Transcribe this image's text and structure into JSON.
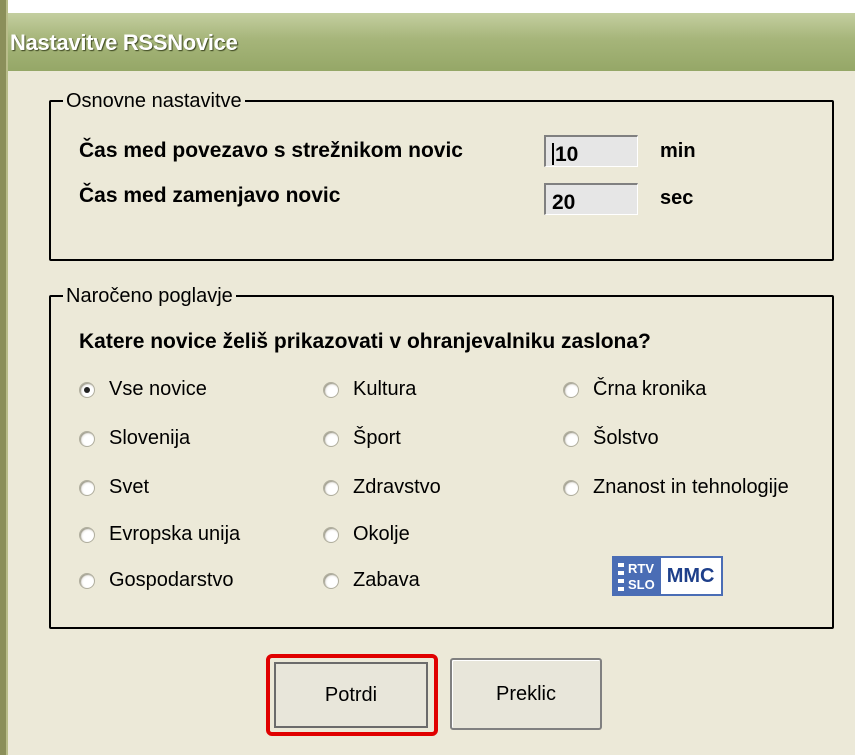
{
  "window": {
    "title": "Nastavitve RSSNovice"
  },
  "basic": {
    "legend": "Osnovne nastavitve",
    "server_interval_label": "Čas med povezavo s strežnikom novic",
    "server_interval_value": "10",
    "server_interval_unit": "min",
    "rotate_interval_label": "Čas med zamenjavo novic",
    "rotate_interval_value": "20",
    "rotate_interval_unit": "sec"
  },
  "subscribed": {
    "legend": "Naročeno poglavje",
    "question": "Katere novice želiš prikazovati v ohranjevalniku zaslona?",
    "options": [
      {
        "label": "Vse novice",
        "checked": true
      },
      {
        "label": "Slovenija",
        "checked": false
      },
      {
        "label": "Svet",
        "checked": false
      },
      {
        "label": "Evropska unija",
        "checked": false
      },
      {
        "label": "Gospodarstvo",
        "checked": false
      },
      {
        "label": "Kultura",
        "checked": false
      },
      {
        "label": "Šport",
        "checked": false
      },
      {
        "label": "Zdravstvo",
        "checked": false
      },
      {
        "label": "Okolje",
        "checked": false
      },
      {
        "label": "Zabava",
        "checked": false
      },
      {
        "label": "Črna kronika",
        "checked": false
      },
      {
        "label": "Šolstvo",
        "checked": false
      },
      {
        "label": "Znanost in tehnologije",
        "checked": false
      }
    ]
  },
  "logo": {
    "rtv_line1": "RTV",
    "rtv_line2": "SLO",
    "mmc": "MMC"
  },
  "buttons": {
    "ok": "Potrdi",
    "cancel": "Preklic"
  },
  "colors": {
    "titlebar": "#a6b57a",
    "window_bg": "#ece9d8",
    "highlight_border": "#e00000"
  }
}
